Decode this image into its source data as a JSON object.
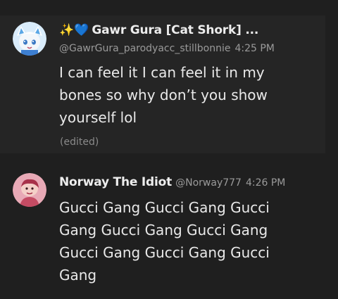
{
  "messages": [
    {
      "emoji": {
        "sparkle": "✨",
        "heart": "💙"
      },
      "display_name": "Gawr Gura [Cat Shork] ...",
      "handle": "@GawrGura_parodyacc_stillbonnie",
      "timestamp": "4:25 PM",
      "text": "I can feel it I can feel it in my bones so why don’t you show yourself lol",
      "edited_label": "(edited)",
      "avatar_icon": "anime-shark-girl-avatar"
    },
    {
      "display_name": "Norway The Idiot",
      "handle": "@Norway777",
      "timestamp": "4:26 PM",
      "text": "Gucci Gang Gucci Gang Gucci Gang Gucci Gang Gucci Gang Gucci Gang Gucci Gang Gucci Gang",
      "avatar_icon": "pink-cartoon-avatar"
    }
  ],
  "colors": {
    "background": "#1f1f1f",
    "highlight_background": "#252525",
    "text_primary": "#e9e9e9",
    "text_secondary": "#9a9a9a"
  }
}
